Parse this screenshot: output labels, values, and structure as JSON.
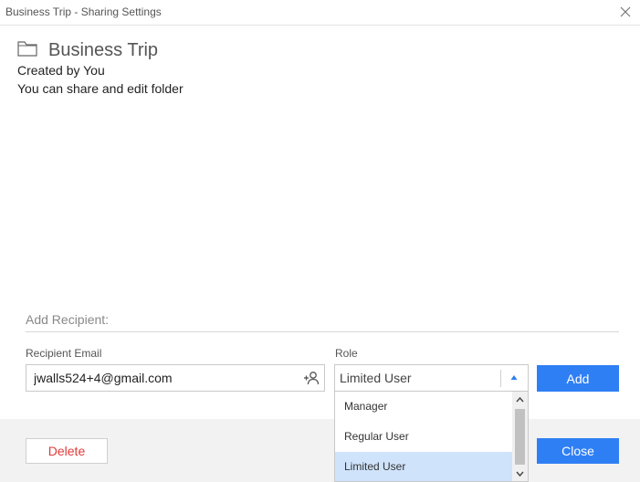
{
  "window": {
    "title": "Business Trip - Sharing Settings"
  },
  "folder": {
    "name": "Business Trip",
    "created_by": "Created by You",
    "permissions": "You can share and edit folder"
  },
  "add_recipient": {
    "section_label": "Add Recipient:",
    "email_label": "Recipient Email",
    "email_value": "jwalls524+4@gmail.com",
    "role_label": "Role",
    "role_value": "Limited User",
    "add_label": "Add"
  },
  "role_dropdown": {
    "options": [
      "Manager",
      "Regular User",
      "Limited User"
    ],
    "selected": "Limited User"
  },
  "footer": {
    "delete_label": "Delete",
    "close_label": "Close"
  },
  "colors": {
    "primary": "#2f7ff4",
    "danger": "#e03a3a",
    "highlight": "#cfe3fb"
  },
  "icons": {
    "close": "close-icon",
    "folder": "folder-icon",
    "add_contact": "add-contact-icon",
    "caret": "caret-up-icon",
    "scroll_up": "chevron-up-icon",
    "scroll_down": "chevron-down-icon"
  }
}
